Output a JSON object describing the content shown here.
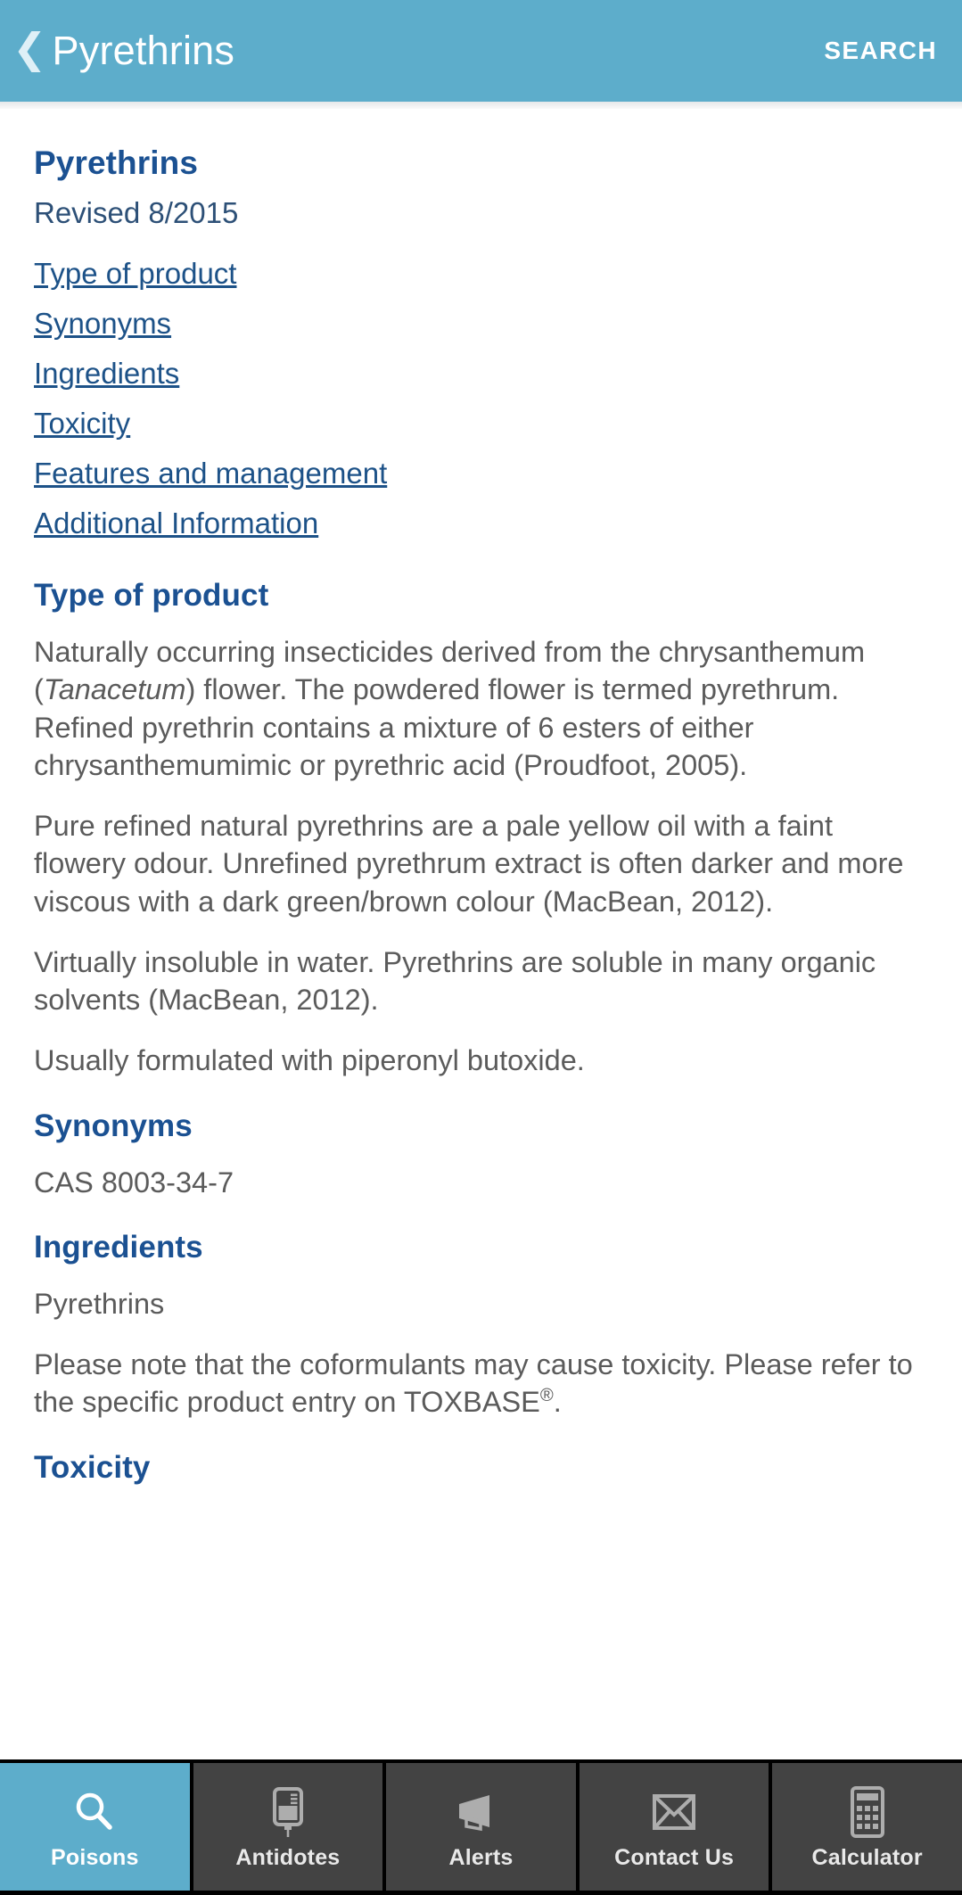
{
  "appbar": {
    "back_icon": "chevron-left-icon",
    "title": "Pyrethrins",
    "search_label": "SEARCH",
    "background_color": "#5dadcb"
  },
  "document": {
    "title": "Pyrethrins",
    "revised": "Revised 8/2015",
    "toc": [
      {
        "label": "Type of product"
      },
      {
        "label": "Synonyms"
      },
      {
        "label": "Ingredients"
      },
      {
        "label": "Toxicity"
      },
      {
        "label": "Features and management"
      },
      {
        "label": "Additional Information"
      }
    ],
    "sections": {
      "type_of_product": {
        "heading": "Type of product",
        "p1_a": "Naturally occurring insecticides derived from the chrysanthemum (",
        "p1_italic": "Tanacetum",
        "p1_b": ") flower. The powdered flower is termed pyrethrum. Refined pyrethrin contains a mixture of 6 esters of either chrysanthemumimic or pyrethric acid (Proudfoot, 2005).",
        "p2": "Pure refined natural pyrethrins are a pale yellow oil with a faint flowery odour. Unrefined pyrethrum extract is often darker and more viscous with a dark green/brown colour (MacBean, 2012).",
        "p3": "Virtually insoluble in water. Pyrethrins are soluble in many organic solvents (MacBean, 2012).",
        "p4": "Usually formulated with piperonyl butoxide."
      },
      "synonyms": {
        "heading": "Synonyms",
        "p1": "CAS 8003-34-7"
      },
      "ingredients": {
        "heading": "Ingredients",
        "p1": "Pyrethrins",
        "p2_a": "Please note that the coformulants may cause toxicity. Please refer to the specific product entry on TOXBASE",
        "p2_sup": "®",
        "p2_b": "."
      },
      "toxicity": {
        "heading": "Toxicity"
      }
    },
    "heading_color": "#1b5192",
    "link_color": "#1d5288",
    "body_color": "#5b5b5b"
  },
  "tabbar": {
    "items": [
      {
        "label": "Poisons",
        "icon": "search-icon",
        "active": true
      },
      {
        "label": "Antidotes",
        "icon": "iv-bag-icon",
        "active": false
      },
      {
        "label": "Alerts",
        "icon": "megaphone-icon",
        "active": false
      },
      {
        "label": "Contact Us",
        "icon": "envelope-icon",
        "active": false
      },
      {
        "label": "Calculator",
        "icon": "calculator-icon",
        "active": false
      }
    ],
    "active_color": "#5dadcb",
    "inactive_color": "#434343"
  }
}
